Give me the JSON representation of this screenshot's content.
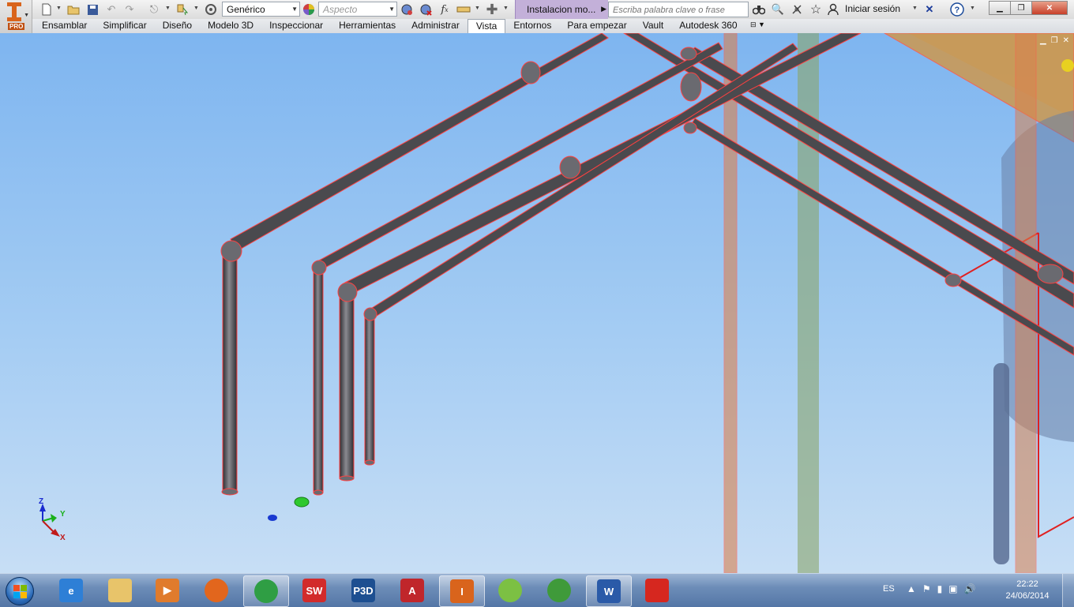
{
  "app": {
    "badge": "PRO",
    "document_title": "Instalacion mo...",
    "search_placeholder": "Escriba palabra clave o frase",
    "signin_label": "Iniciar sesión",
    "material_value": "Genérico",
    "appearance_value": "Aspecto"
  },
  "quick_access": {
    "icons": [
      "new-icon",
      "open-icon",
      "save-icon",
      "undo-icon",
      "redo-icon",
      "return-icon",
      "select-icon",
      "update-icon",
      "material-icon",
      "appearance-icon",
      "adjust-icon",
      "clear-appearance-icon",
      "fx-icon",
      "measure-icon",
      "add-icon"
    ]
  },
  "ribbon": {
    "tabs": [
      "Ensamblar",
      "Simplificar",
      "Diseño",
      "Modelo 3D",
      "Inspeccionar",
      "Herramientas",
      "Administrar",
      "Vista",
      "Entornos",
      "Para empezar",
      "Vault",
      "Autodesk 360"
    ],
    "active_tab": "Vista"
  },
  "viewport": {
    "triad": {
      "z": "Z",
      "y": "Y",
      "x": "X"
    },
    "colors": {
      "pipe": "#4a4a4e",
      "highlight": "#ff4040",
      "column_orange": "#d9824e",
      "column_green": "#8aa56a",
      "tank": "#5a6f94"
    }
  },
  "taskbar": {
    "apps": [
      {
        "name": "internet-explorer",
        "label": "e",
        "color": "#2e7fd6"
      },
      {
        "name": "file-explorer",
        "label": "",
        "color": "#e8c46a"
      },
      {
        "name": "media-player",
        "label": "▶",
        "color": "#e07b2c"
      },
      {
        "name": "firefox",
        "label": "",
        "color": "#e2661d"
      },
      {
        "name": "chrome",
        "label": "",
        "color": "#2f9e44"
      },
      {
        "name": "solidworks",
        "label": "SW",
        "color": "#d22b2b"
      },
      {
        "name": "autocad-p3d",
        "label": "P3D",
        "color": "#1d4f91"
      },
      {
        "name": "autocad",
        "label": "A",
        "color": "#c0262b"
      },
      {
        "name": "inventor",
        "label": "I",
        "color": "#d9641c"
      },
      {
        "name": "picasa",
        "label": "",
        "color": "#7cc043"
      },
      {
        "name": "xbox-app",
        "label": "",
        "color": "#3f9a3a"
      },
      {
        "name": "word",
        "label": "W",
        "color": "#2a5aa8"
      },
      {
        "name": "acrobat",
        "label": "",
        "color": "#d6271f"
      }
    ],
    "language": "ES",
    "time": "22:22",
    "date": "24/06/2014"
  }
}
